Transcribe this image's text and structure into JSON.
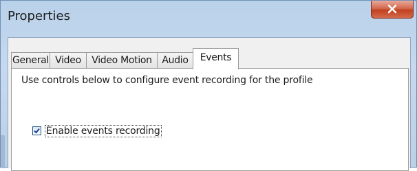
{
  "window": {
    "title": "Properties",
    "close_icon": "close-icon"
  },
  "tabs": [
    {
      "label": "General",
      "active": false
    },
    {
      "label": "Video",
      "active": false
    },
    {
      "label": "Video Motion",
      "active": false
    },
    {
      "label": "Audio",
      "active": false
    },
    {
      "label": "Events",
      "active": true
    }
  ],
  "events_panel": {
    "description": "Use controls below to configure event recording for the profile",
    "enable_checkbox": {
      "label": "Enable events recording",
      "checked": true
    }
  }
}
